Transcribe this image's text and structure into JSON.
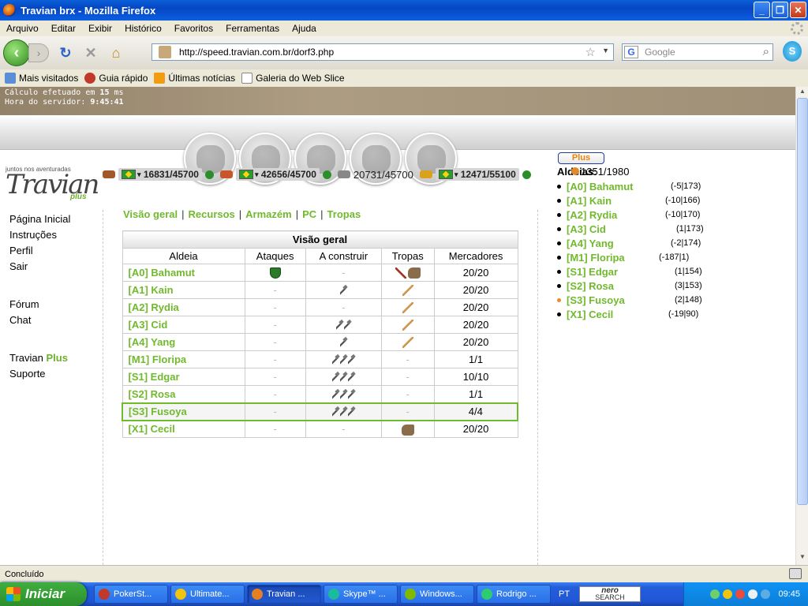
{
  "window": {
    "title": "Travian brx - Mozilla Firefox"
  },
  "menu": [
    "Arquivo",
    "Editar",
    "Exibir",
    "Histórico",
    "Favoritos",
    "Ferramentas",
    "Ajuda"
  ],
  "nav": {
    "url": "http://speed.travian.com.br/dorf3.php",
    "search_placeholder": "Google"
  },
  "bookmarks": [
    "Mais visitados",
    "Guia rápido",
    "Últimas notícias",
    "Galeria do Web Slice"
  ],
  "game": {
    "calc_label": "Cálculo efetuado em",
    "calc_value": "15",
    "calc_unit": "ms",
    "server_label": "Hora do servidor:",
    "server_time": "9:45:41",
    "plus_button": "Plus",
    "logo_top": "juntos nos aventuradas",
    "logo_text": "Travian",
    "logo_sub": "plus",
    "resources": [
      {
        "name": "madeira",
        "value": "16831/45700",
        "color": "#a2592a"
      },
      {
        "name": "barro",
        "value": "42656/45700",
        "color": "#c8552b"
      },
      {
        "name": "ferro",
        "value": "20731/45700",
        "color": "#888888"
      },
      {
        "name": "cereal",
        "value": "12471/55100",
        "color": "#d9a21c"
      }
    ],
    "left_nav": {
      "group1": [
        "Página Inicial",
        "Instruções",
        "Perfil",
        "Sair"
      ],
      "group2": [
        "Fórum",
        "Chat"
      ],
      "travian_word": "Travian",
      "plus_word": "Plus",
      "suporte": "Suporte"
    },
    "tabs": [
      "Visão geral",
      "Recursos",
      "Armazém",
      "PC",
      "Tropas"
    ],
    "table": {
      "caption": "Visão geral",
      "headers": [
        "Aldeia",
        "Ataques",
        "A construir",
        "Tropas",
        "Mercadores"
      ],
      "rows": [
        {
          "name": "[A0] Bahamut",
          "attacks": "shield",
          "build": 0,
          "troops": [
            "sword2",
            "horse"
          ],
          "merchants": "20/20"
        },
        {
          "name": "[A1] Kain",
          "attacks": "",
          "build": 1,
          "troops": [
            "sword"
          ],
          "merchants": "20/20"
        },
        {
          "name": "[A2] Rydia",
          "attacks": "",
          "build": 0,
          "troops": [
            "sword"
          ],
          "merchants": "20/20"
        },
        {
          "name": "[A3] Cid",
          "attacks": "",
          "build": 2,
          "troops": [
            "sword"
          ],
          "merchants": "20/20"
        },
        {
          "name": "[A4] Yang",
          "attacks": "",
          "build": 1,
          "troops": [
            "sword"
          ],
          "merchants": "20/20"
        },
        {
          "name": "[M1] Floripa",
          "attacks": "",
          "build": 3,
          "troops": [],
          "merchants": "1/1"
        },
        {
          "name": "[S1] Edgar",
          "attacks": "",
          "build": 3,
          "troops": [],
          "merchants": "10/10"
        },
        {
          "name": "[S2] Rosa",
          "attacks": "",
          "build": 3,
          "troops": [],
          "merchants": "1/1"
        },
        {
          "name": "[S3] Fusoya",
          "attacks": "",
          "build": 3,
          "troops": [],
          "merchants": "4/4",
          "active": true
        },
        {
          "name": "[X1] Cecil",
          "attacks": "",
          "build": 0,
          "troops": [
            "horse"
          ],
          "merchants": "20/20"
        }
      ]
    },
    "villages_title": "Aldeias:",
    "culture_value": "1351/1980",
    "villages": [
      {
        "name": "[A0] Bahamut",
        "coords": "(-5|173)"
      },
      {
        "name": "[A1] Kain",
        "coords": "(-10|166)"
      },
      {
        "name": "[A2] Rydia",
        "coords": "(-10|170)"
      },
      {
        "name": "[A3] Cid",
        "coords": "(1|173)"
      },
      {
        "name": "[A4] Yang",
        "coords": "(-2|174)"
      },
      {
        "name": "[M1] Floripa",
        "coords": "(-187|1)"
      },
      {
        "name": "[S1] Edgar",
        "coords": "(1|154)"
      },
      {
        "name": "[S2] Rosa",
        "coords": "(3|153)"
      },
      {
        "name": "[S3] Fusoya",
        "coords": "(2|148)",
        "current": true
      },
      {
        "name": "[X1] Cecil",
        "coords": "(-19|90)"
      }
    ]
  },
  "statusbar": {
    "text": "Concluído"
  },
  "taskbar": {
    "start": "Iniciar",
    "tasks": [
      {
        "label": "PokerSt...",
        "color": "#c0392b"
      },
      {
        "label": "Ultimate...",
        "color": "#f1c40f"
      },
      {
        "label": "Travian ...",
        "color": "#e67e22",
        "active": true
      },
      {
        "label": "Skype™ ...",
        "color": "#1abc9c"
      },
      {
        "label": "Windows...",
        "color": "#7fba00"
      },
      {
        "label": "Rodrigo ...",
        "color": "#2ecc71"
      }
    ],
    "lang": "PT",
    "nero_line1": "nero",
    "nero_line2": "SEARCH",
    "clock": "09:45"
  }
}
